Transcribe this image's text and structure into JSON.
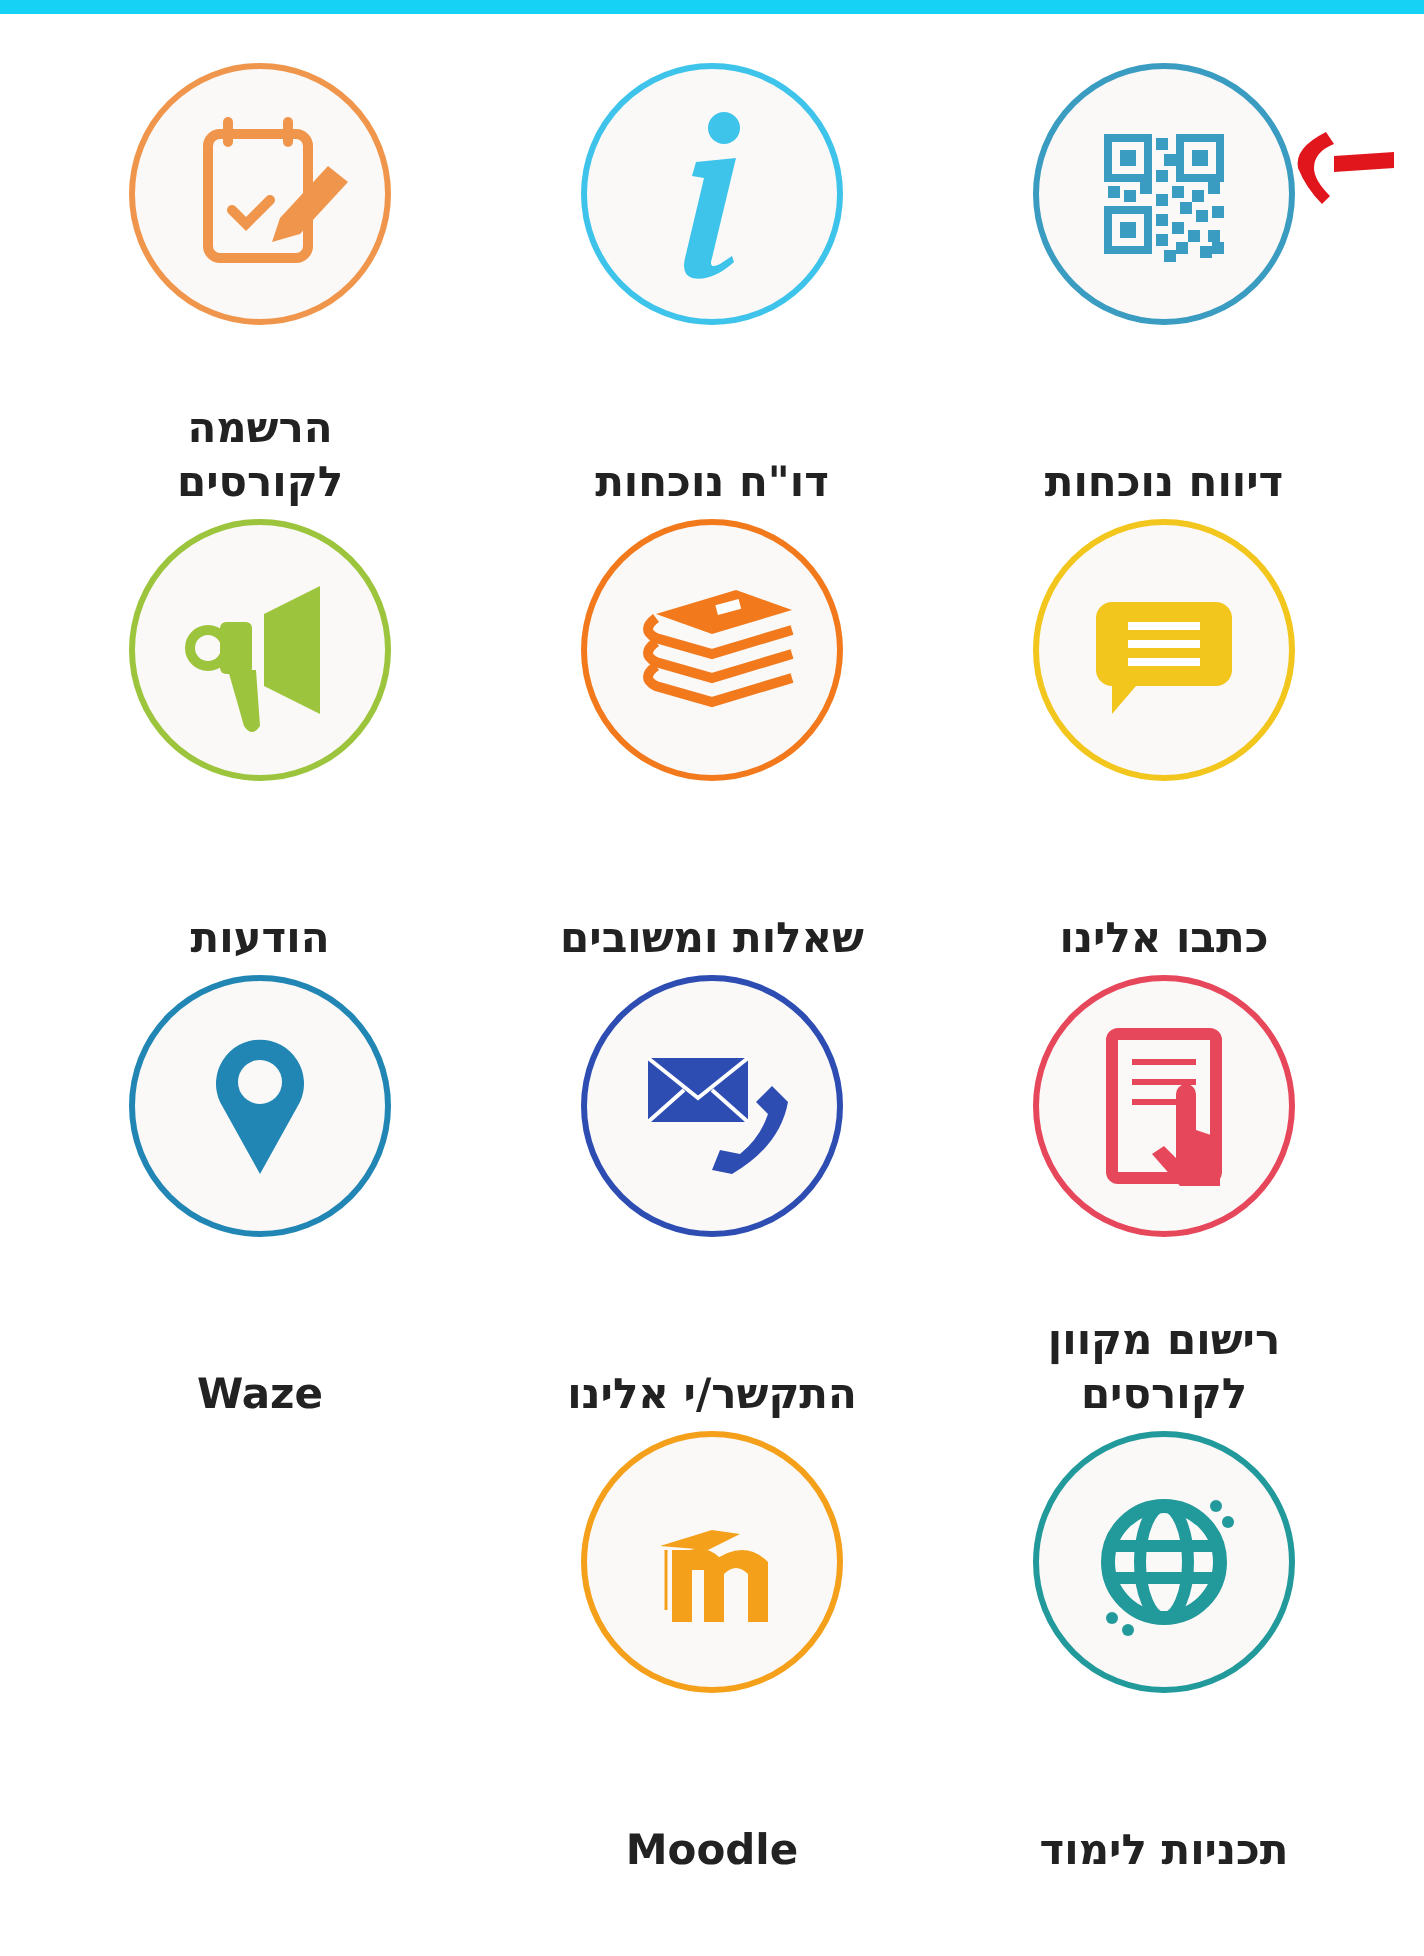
{
  "items": [
    {
      "label": "דיווח נוכחות",
      "kind": "qr",
      "color": "#3a9cc0",
      "highlighted": true
    },
    {
      "label": "דו\"ח נוכחות",
      "kind": "info",
      "color": "#3ec4ea",
      "highlighted": false
    },
    {
      "label": "הרשמה\nלקורסים",
      "kind": "clipboard",
      "color": "#f0964c",
      "highlighted": false
    },
    {
      "label": "כתבו אלינו",
      "kind": "chat",
      "color": "#f2c61c",
      "highlighted": false
    },
    {
      "label": "שאלות ומשובים",
      "kind": "books",
      "color": "#f27a1c",
      "highlighted": false
    },
    {
      "label": "הודעות",
      "kind": "megaphone",
      "color": "#9cc43c",
      "highlighted": false
    },
    {
      "label": "רישום מקוון\nלקורסים",
      "kind": "tablet",
      "color": "#e6475a",
      "highlighted": false
    },
    {
      "label": "התקשר/י אלינו",
      "kind": "contact",
      "color": "#2d4db3",
      "highlighted": false
    },
    {
      "label": "Waze",
      "kind": "pin",
      "color": "#2186b4",
      "highlighted": false
    },
    {
      "label": "תכניות לימוד",
      "kind": "globe",
      "color": "#22999a",
      "highlighted": false
    },
    {
      "label": "Moodle",
      "kind": "moodle",
      "color": "#f5a01a",
      "highlighted": false
    }
  ]
}
